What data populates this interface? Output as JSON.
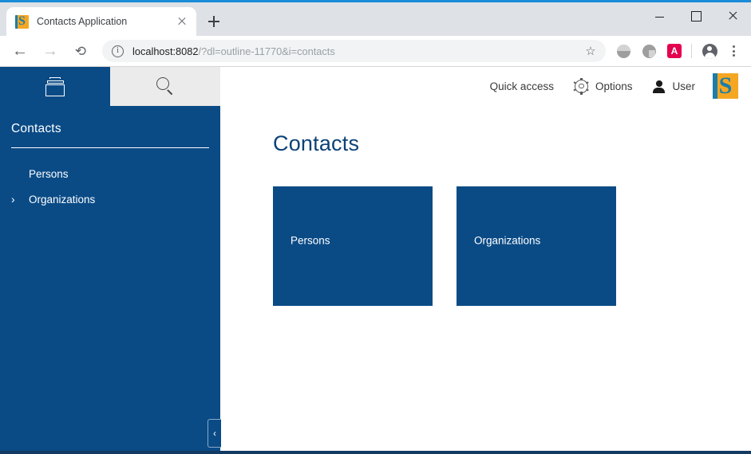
{
  "browser": {
    "tab": {
      "title": "Contacts Application",
      "favicon_letter": "S",
      "close_icon": "close-icon"
    },
    "new_tab_label": "+",
    "window_controls": {
      "minimize": "minimize",
      "maximize": "maximize",
      "close": "close"
    },
    "toolbar": {
      "back": "←",
      "forward": "→",
      "reload": "⟳",
      "info_icon": "info-icon",
      "url_host": "localhost:8082",
      "url_path": "/?dl=outline-11770&i=contacts",
      "url_full": "localhost:8082/?dl=outline-11770&i=contacts",
      "star": "☆",
      "extension_badge_letter": "A",
      "kebab": "more-options"
    }
  },
  "app": {
    "sidebar": {
      "tabs": [
        {
          "name": "archive-box",
          "icon": "box-icon"
        },
        {
          "name": "search",
          "icon": "search-icon"
        }
      ],
      "title": "Contacts",
      "nav_items": [
        {
          "label": "Persons",
          "has_chevron": false
        },
        {
          "label": "Organizations",
          "has_chevron": true
        }
      ],
      "collapse_glyph": "‹"
    },
    "header": {
      "quick_access": "Quick access",
      "options": "Options",
      "user": "User",
      "logo_letter": "S"
    },
    "main": {
      "page_title": "Contacts",
      "tiles": [
        {
          "label": "Persons"
        },
        {
          "label": "Organizations"
        }
      ]
    }
  },
  "colors": {
    "brand_blue": "#0a4b86",
    "title_blue": "#0d4277",
    "logo_orange": "#f5a623",
    "logo_teal": "#1b7ea8",
    "browser_accent": "#1a8cd8",
    "search_tab_bg": "#ebebeb",
    "bottom_bar": "#123a63"
  }
}
